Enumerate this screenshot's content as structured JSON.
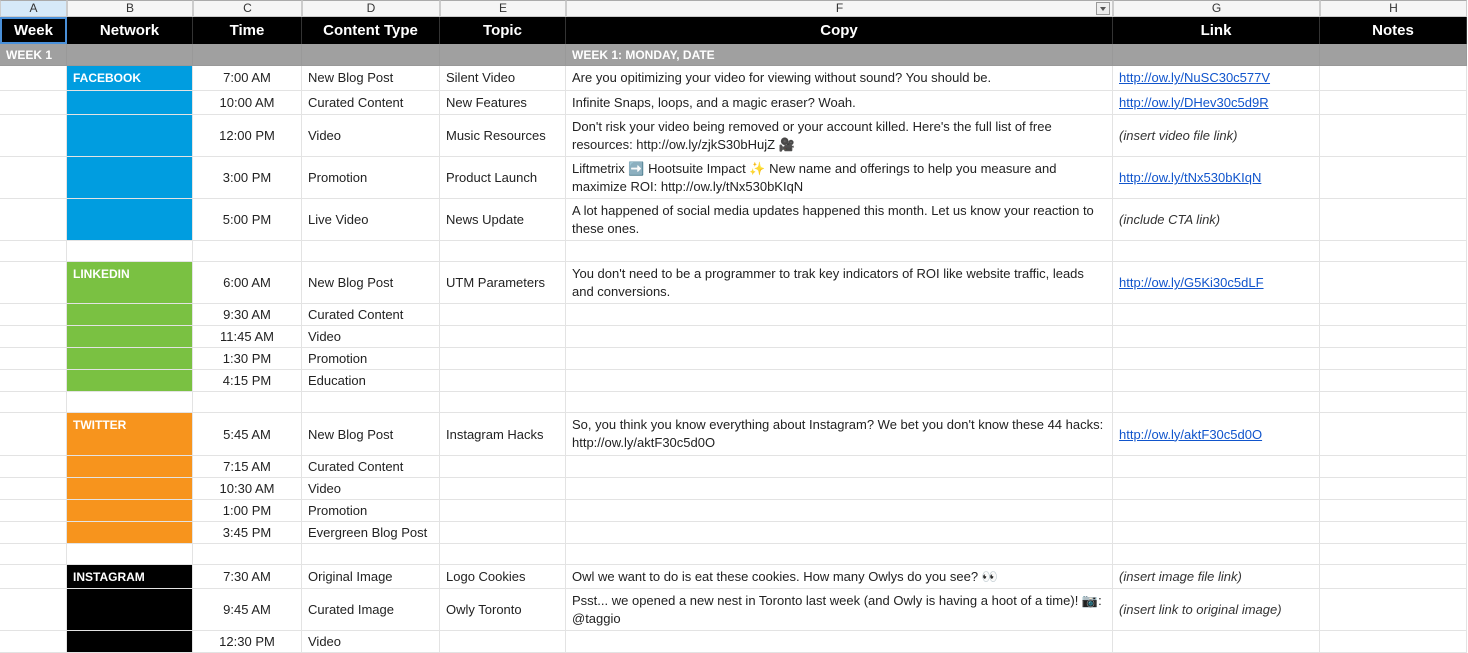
{
  "cols": [
    "A",
    "B",
    "C",
    "D",
    "E",
    "F",
    "G",
    "H"
  ],
  "headers": [
    "Week",
    "Network",
    "Time",
    "Content Type",
    "Topic",
    "Copy",
    "Link",
    "Notes"
  ],
  "week_tab": "WEEK 1",
  "week_title": "WEEK 1: MONDAY, DATE",
  "networks": {
    "fb": "FACEBOOK",
    "li": "LINKEDIN",
    "tw": "TWITTER",
    "ig": "INSTAGRAM"
  },
  "rows": [
    {
      "net": "fb",
      "time": "7:00 AM",
      "type": "New Blog Post",
      "topic": "Silent Video",
      "copy": "Are you opitimizing your video for viewing without sound? You should be.",
      "link": "http://ow.ly/NuSC30c577V",
      "notes": ""
    },
    {
      "net": "fb",
      "time": "10:00 AM",
      "type": "Curated Content",
      "topic": "New Features",
      "copy": "Infinite Snaps, loops, and a magic eraser? Woah.",
      "link": "http://ow.ly/DHev30c5d9R",
      "notes": ""
    },
    {
      "net": "fb",
      "time": "12:00 PM",
      "type": "Video",
      "topic": "Music Resources",
      "copy": "Don't risk your video being removed or your account killed. Here's the full list of free resources: http://ow.ly/zjkS30bHujZ 🎥",
      "link": "",
      "notes": "(insert video file link)",
      "tall": true
    },
    {
      "net": "fb",
      "time": "3:00 PM",
      "type": "Promotion",
      "topic": "Product Launch",
      "copy": "Liftmetrix ➡️ Hootsuite Impact ✨ New name and offerings to help you measure and maximize ROI: http://ow.ly/tNx530bKIqN",
      "link": "http://ow.ly/tNx530bKIqN",
      "notes": "",
      "tall": true
    },
    {
      "net": "fb",
      "time": "5:00 PM",
      "type": "Live Video",
      "topic": "News Update",
      "copy": "A lot happened of social media updates happened this month. Let us know your reaction to these ones.",
      "link": "",
      "notes": "(include CTA link)",
      "tall": true
    },
    {
      "spacer": true
    },
    {
      "net": "li",
      "time": "6:00 AM",
      "type": "New Blog Post",
      "topic": "UTM Parameters",
      "copy": "You don't need to be a programmer to trak key indicators of ROI like website traffic, leads and conversions.",
      "link": "http://ow.ly/G5Ki30c5dLF",
      "notes": "",
      "tall": true
    },
    {
      "net": "li",
      "time": "9:30 AM",
      "type": "Curated Content",
      "topic": "",
      "copy": "",
      "link": "",
      "notes": ""
    },
    {
      "net": "li",
      "time": "11:45 AM",
      "type": "Video",
      "topic": "",
      "copy": "",
      "link": "",
      "notes": ""
    },
    {
      "net": "li",
      "time": "1:30 PM",
      "type": "Promotion",
      "topic": "",
      "copy": "",
      "link": "",
      "notes": ""
    },
    {
      "net": "li",
      "time": "4:15 PM",
      "type": "Education",
      "topic": "",
      "copy": "",
      "link": "",
      "notes": ""
    },
    {
      "spacer": true
    },
    {
      "net": "tw",
      "time": "5:45 AM",
      "type": "New Blog Post",
      "topic": "Instagram Hacks",
      "copy": "So, you think you know everything about Instagram? We bet you don't know these 44 hacks: http://ow.ly/aktF30c5d0O",
      "link": "http://ow.ly/aktF30c5d0O",
      "notes": "",
      "tall": true
    },
    {
      "net": "tw",
      "time": "7:15 AM",
      "type": "Curated Content",
      "topic": "",
      "copy": "",
      "link": "",
      "notes": ""
    },
    {
      "net": "tw",
      "time": "10:30 AM",
      "type": "Video",
      "topic": "",
      "copy": "",
      "link": "",
      "notes": ""
    },
    {
      "net": "tw",
      "time": "1:00 PM",
      "type": "Promotion",
      "topic": "",
      "copy": "",
      "link": "",
      "notes": ""
    },
    {
      "net": "tw",
      "time": "3:45 PM",
      "type": "Evergreen Blog Post",
      "topic": "",
      "copy": "",
      "link": "",
      "notes": ""
    },
    {
      "spacer": true
    },
    {
      "net": "ig",
      "time": "7:30 AM",
      "type": "Original Image",
      "topic": "Logo Cookies",
      "copy": "Owl we want to do is eat these cookies. How many Owlys do you see? 👀",
      "link": "",
      "notes": "(insert image file link)"
    },
    {
      "net": "ig",
      "time": "9:45 AM",
      "type": "Curated Image",
      "topic": "Owly Toronto",
      "copy": "Psst... we opened a new nest in Toronto last week (and Owly is having a hoot of a time)! 📷: @taggio",
      "link": "",
      "notes": "(insert link to original image)",
      "tall": true
    },
    {
      "net": "ig",
      "time": "12:30 PM",
      "type": "Video",
      "topic": "",
      "copy": "",
      "link": "",
      "notes": ""
    }
  ]
}
